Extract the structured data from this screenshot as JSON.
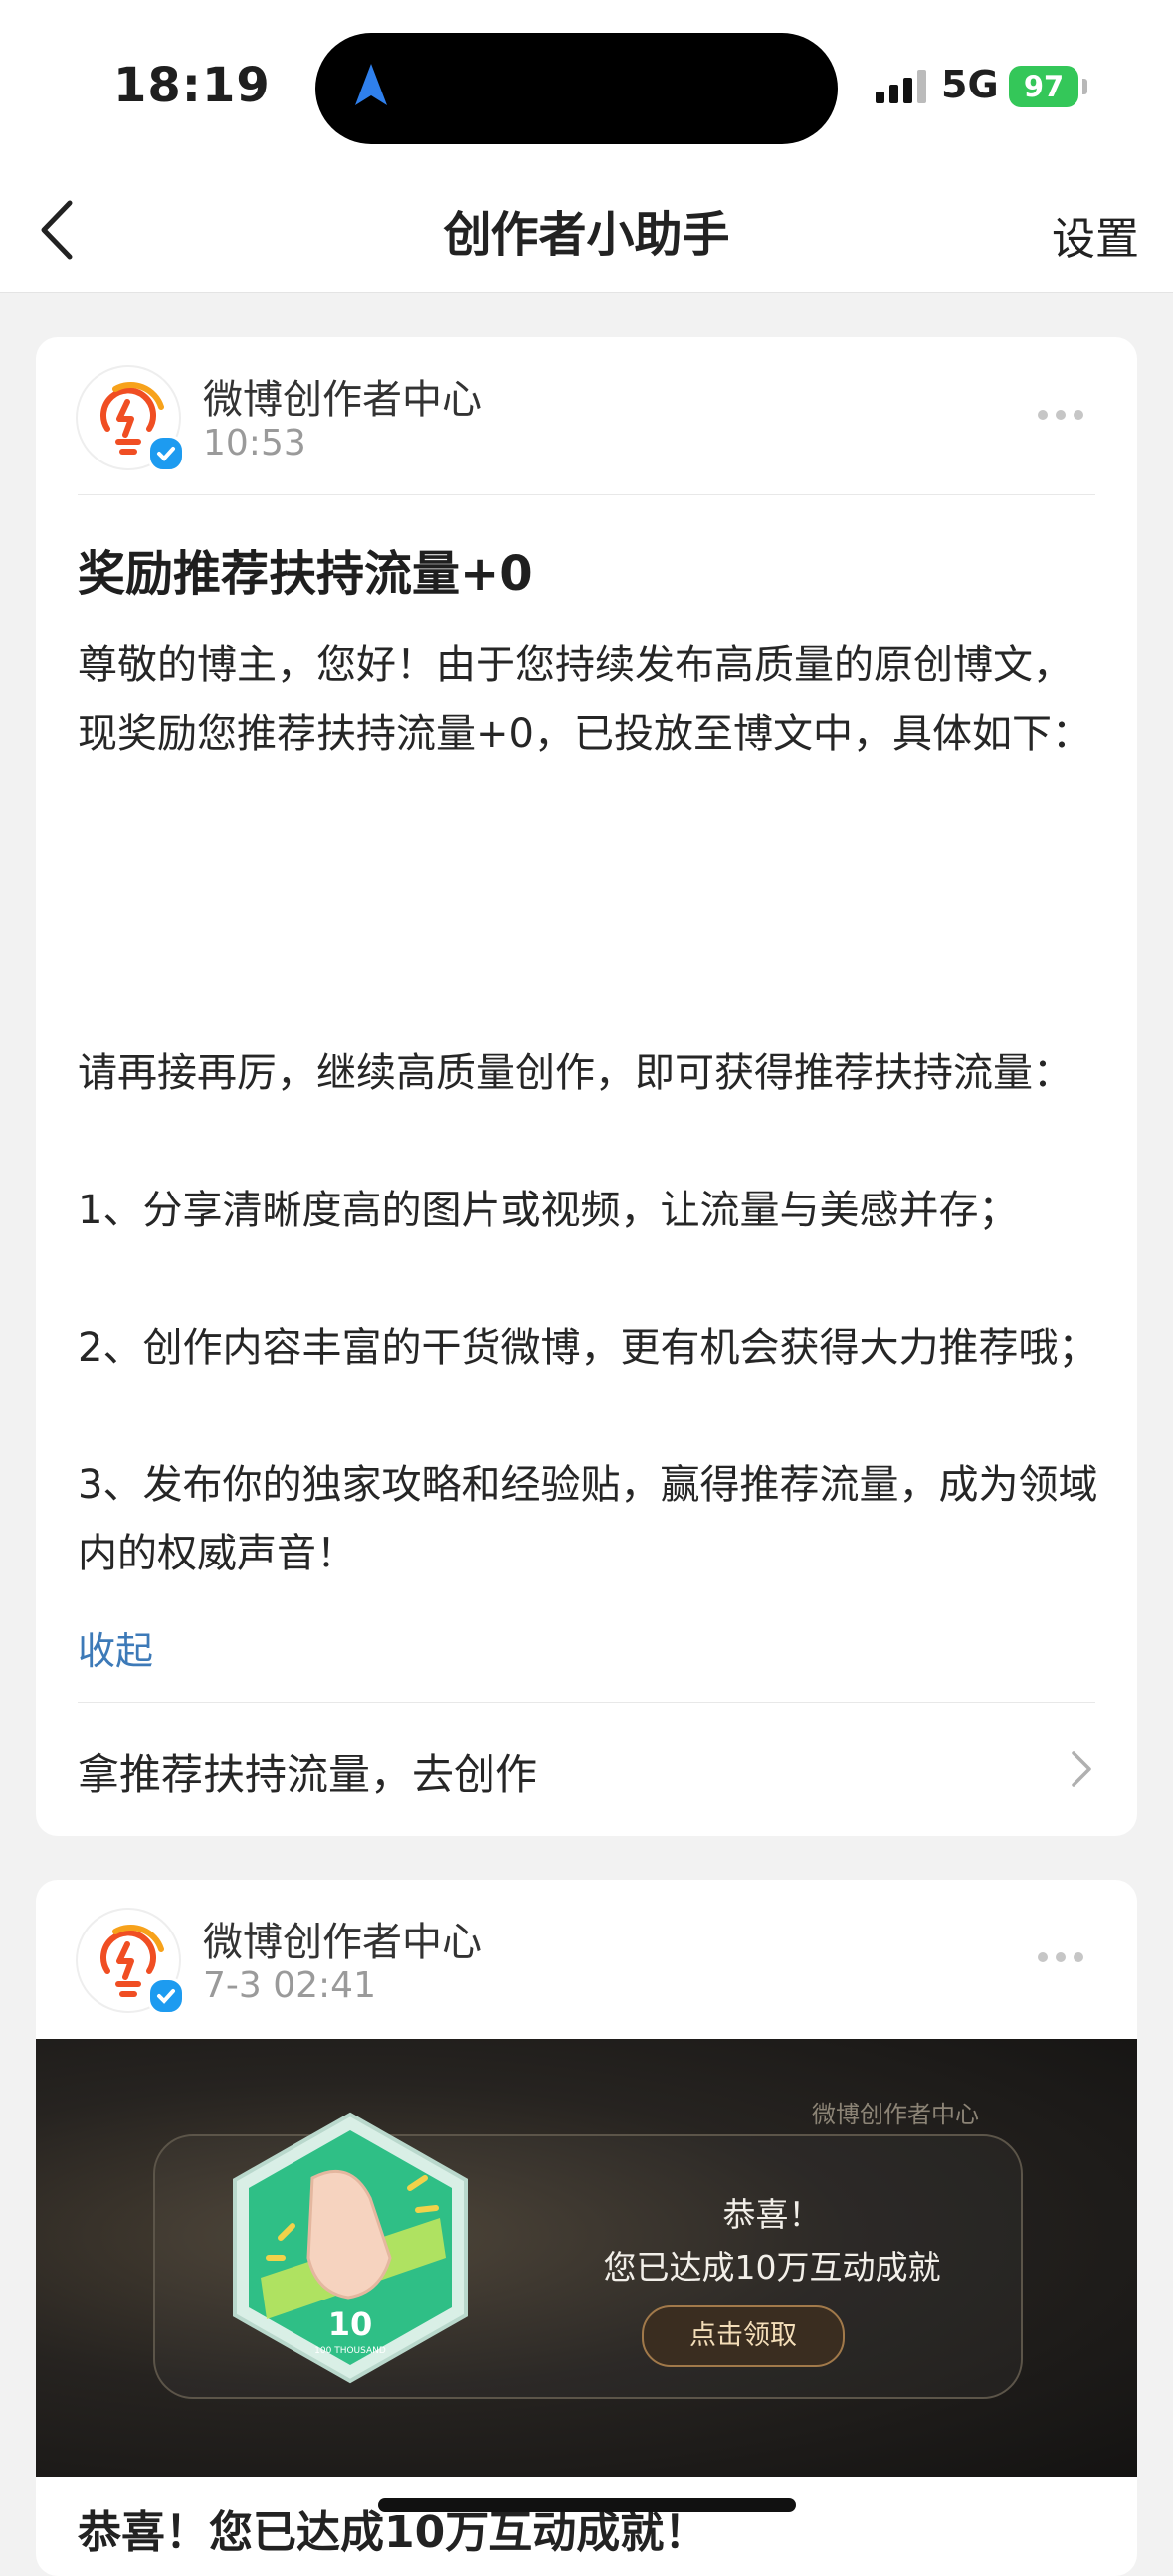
{
  "status_bar": {
    "time": "18:19",
    "network": "5G",
    "battery": "97"
  },
  "header": {
    "title": "创作者小助手",
    "settings_label": "设置"
  },
  "messages": [
    {
      "sender": "微博创作者中心",
      "time": "10:53",
      "title": "奖励推荐扶持流量+0",
      "intro": "尊敬的博主，您好！由于您持续发布高质量的原创博文，现奖励您推荐扶持流量+0，已投放至博文中，具体如下：",
      "tips_intro": "请再接再厉，继续高质量创作，即可获得推荐扶持流量：",
      "tips": [
        "1、分享清晰度高的图片或视频，让流量与美感并存；",
        "2、创作内容丰富的干货微博，更有机会获得大力推荐哦；",
        "3、发布你的独家攻略和经验贴，赢得推荐流量，成为领域内的权威声音！"
      ],
      "collapse_label": "收起",
      "action_label": "拿推荐扶持流量，去创作"
    },
    {
      "sender": "微博创作者中心",
      "time": "7-3 02:41",
      "banner": {
        "logo_text": "微博创作者中心",
        "badge_number": "10",
        "badge_caption": "100 THOUSAND",
        "congrats": "恭喜！",
        "achievement": "您已达成10万互动成就",
        "claim_label": "点击领取"
      },
      "title_partial": "恭喜！您已达成10万互动成就！"
    }
  ],
  "colors": {
    "accent_link": "#3d7ab8",
    "battery_green": "#34c759",
    "verified_blue": "#1d9bf0",
    "badge_green": "#2fbf86"
  }
}
